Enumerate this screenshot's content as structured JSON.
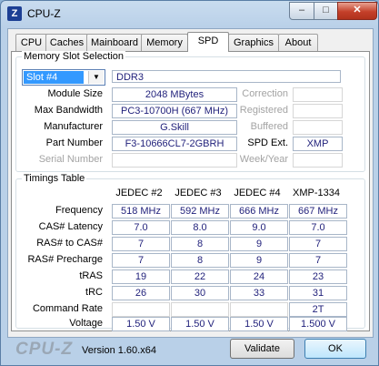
{
  "window": {
    "icon_letter": "Z",
    "title": "CPU-Z",
    "min_glyph": "–",
    "max_glyph": "□",
    "close_glyph": "✕"
  },
  "tabs": [
    "CPU",
    "Caches",
    "Mainboard",
    "Memory",
    "SPD",
    "Graphics",
    "About"
  ],
  "active_tab": "SPD",
  "slot_section": {
    "title": "Memory Slot Selection",
    "selected_slot": "Slot #4",
    "memory_type": "DDR3",
    "fields": {
      "module_size_label": "Module Size",
      "module_size": "2048 MBytes",
      "max_bandwidth_label": "Max Bandwidth",
      "max_bandwidth": "PC3-10700H (667 MHz)",
      "manufacturer_label": "Manufacturer",
      "manufacturer": "G.Skill",
      "part_number_label": "Part Number",
      "part_number": "F3-10666CL7-2GBRH",
      "serial_number_label": "Serial Number",
      "serial_number": "",
      "correction_label": "Correction",
      "correction": "",
      "registered_label": "Registered",
      "registered": "",
      "buffered_label": "Buffered",
      "buffered": "",
      "spd_ext_label": "SPD Ext.",
      "spd_ext": "XMP",
      "week_year_label": "Week/Year",
      "week_year": ""
    }
  },
  "timings": {
    "title": "Timings Table",
    "columns": [
      "JEDEC #2",
      "JEDEC #3",
      "JEDEC #4",
      "XMP-1334"
    ],
    "rows": [
      {
        "label": "Frequency",
        "values": [
          "518 MHz",
          "592 MHz",
          "666 MHz",
          "667 MHz"
        ]
      },
      {
        "label": "CAS# Latency",
        "values": [
          "7.0",
          "8.0",
          "9.0",
          "7.0"
        ]
      },
      {
        "label": "RAS# to CAS#",
        "values": [
          "7",
          "8",
          "9",
          "7"
        ]
      },
      {
        "label": "RAS# Precharge",
        "values": [
          "7",
          "8",
          "9",
          "7"
        ]
      },
      {
        "label": "tRAS",
        "values": [
          "19",
          "22",
          "24",
          "23"
        ]
      },
      {
        "label": "tRC",
        "values": [
          "26",
          "30",
          "33",
          "31"
        ]
      },
      {
        "label": "Command Rate",
        "values": [
          "",
          "",
          "",
          "2T"
        ]
      },
      {
        "label": "Voltage",
        "values": [
          "1.50 V",
          "1.50 V",
          "1.50 V",
          "1.500 V"
        ]
      }
    ]
  },
  "footer": {
    "brand": "CPU-Z",
    "version": "Version 1.60.x64",
    "validate_label": "Validate",
    "ok_label": "OK"
  }
}
